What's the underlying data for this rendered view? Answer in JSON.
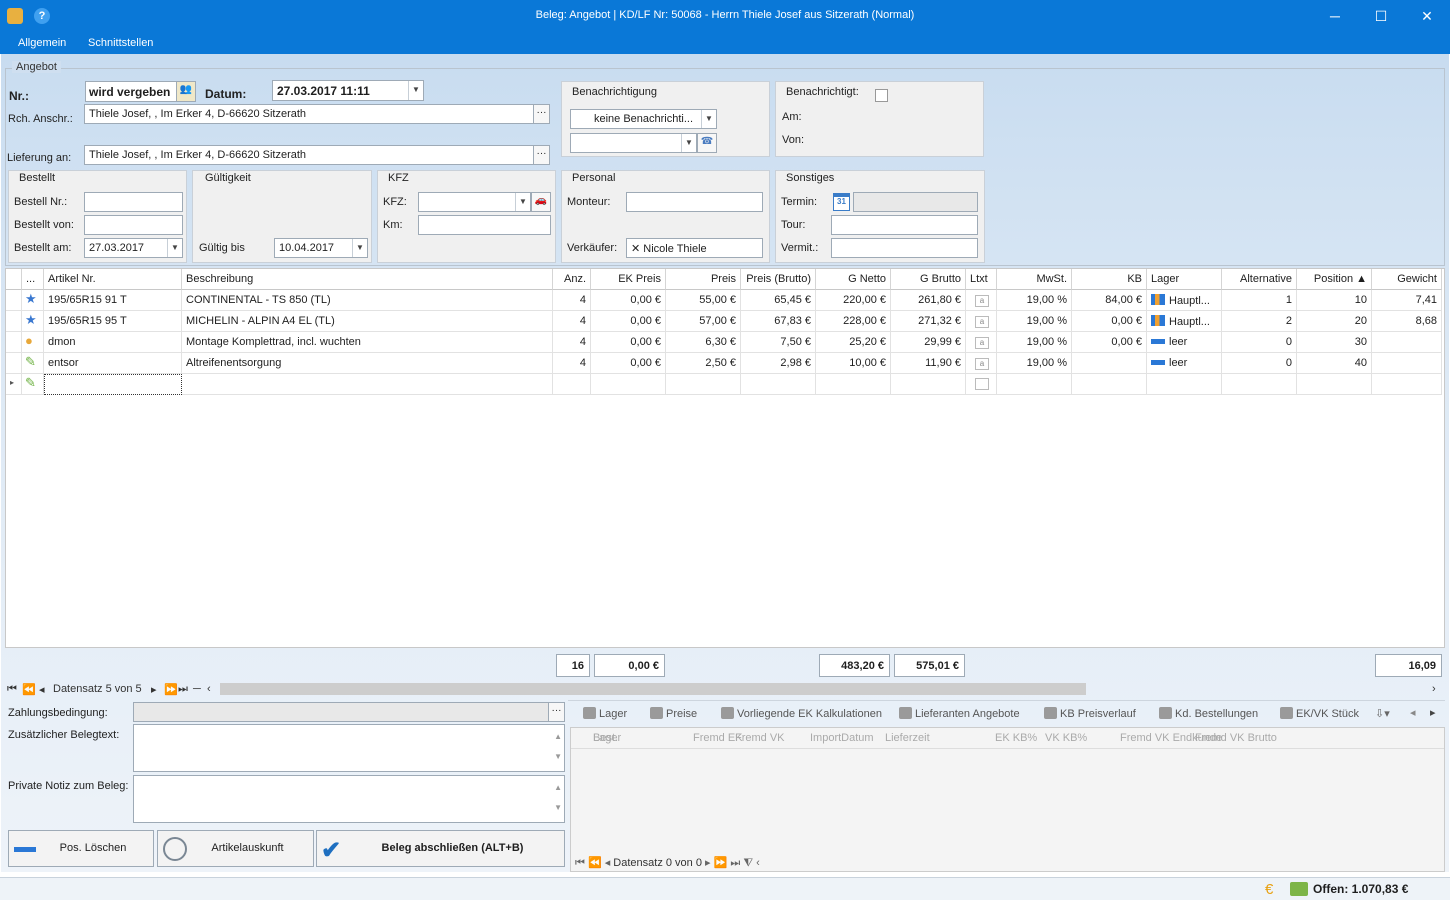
{
  "window": {
    "title": "Beleg: Angebot  |  KD/LF Nr: 50068 - Herrn Thiele Josef aus Sitzerath (Normal)",
    "minimize": "─",
    "maximize": "☐",
    "close": "✕"
  },
  "menu": [
    "Allgemein",
    "Schnittstellen"
  ],
  "angebot": {
    "group_title": "Angebot",
    "nr_label": "Nr.:",
    "nr_value": "wird vergeben",
    "datum_label": "Datum:",
    "datum_value": "27.03.2017 11:11",
    "rch_label": "Rch. Anschr.:",
    "rch_value": "Thiele Josef, , Im Erker 4, D-66620 Sitzerath",
    "lieferung_label": "Lieferung an:",
    "lieferung_value": "Thiele Josef, , Im Erker 4, D-66620 Sitzerath"
  },
  "benachrichtigung": {
    "title": "Benachrichtigung",
    "select_value": "keine Benachrichti..."
  },
  "benachrichtigt": {
    "title": "Benachrichtigt:",
    "am_label": "Am:",
    "von_label": "Von:"
  },
  "bestellt": {
    "title": "Bestellt",
    "nr_label": "Bestell Nr.:",
    "von_label": "Bestellt von:",
    "am_label": "Bestellt am:",
    "am_value": "27.03.2017"
  },
  "gueltigkeit": {
    "title": "Gültigkeit",
    "bis_label": "Gültig bis",
    "bis_value": "10.04.2017"
  },
  "kfz": {
    "title": "KFZ",
    "kfz_label": "KFZ:",
    "km_label": "Km:"
  },
  "personal": {
    "title": "Personal",
    "monteur_label": "Monteur:",
    "verkaeufer_label": "Verkäufer:",
    "verkaeufer_value": "✕ Nicole Thiele"
  },
  "sonstiges": {
    "title": "Sonstiges",
    "termin_label": "Termin:",
    "termin_icon": "31",
    "tour_label": "Tour:",
    "vermit_label": "Vermit.:"
  },
  "grid": {
    "columns": [
      "...",
      "Artikel Nr.",
      "Beschreibung",
      "Anz.",
      "EK Preis",
      "Preis",
      "Preis (Brutto)",
      "G Netto",
      "G Brutto",
      "Ltxt",
      "MwSt.",
      "KB",
      "Lager",
      "Alternative",
      "Position ▲",
      "Gewicht"
    ],
    "rows": [
      {
        "icon": "star",
        "art": "195/65R15 91 T",
        "desc": "CONTINENTAL - TS 850 (TL)",
        "anz": "4",
        "ek": "0,00 €",
        "preis": "55,00 €",
        "brutto": "65,45 €",
        "gnetto": "220,00 €",
        "gbrutto": "261,80 €",
        "ltxt": "a",
        "mwst": "19,00 %",
        "kb": "84,00 €",
        "lager": "Hauptl...",
        "lagericon": "chart",
        "alt": "1",
        "pos": "10",
        "gewicht": "7,41"
      },
      {
        "icon": "star",
        "art": "195/65R15 95 T",
        "desc": "MICHELIN - ALPIN A4 EL (TL)",
        "anz": "4",
        "ek": "0,00 €",
        "preis": "57,00 €",
        "brutto": "67,83 €",
        "gnetto": "228,00 €",
        "gbrutto": "271,32 €",
        "ltxt": "a",
        "mwst": "19,00 %",
        "kb": "0,00 €",
        "lager": "Hauptl...",
        "lagericon": "chart",
        "alt": "2",
        "pos": "20",
        "gewicht": "8,68"
      },
      {
        "icon": "person",
        "art": "dmon",
        "desc": "Montage Komplettrad, incl. wuchten",
        "anz": "4",
        "ek": "0,00 €",
        "preis": "6,30 €",
        "brutto": "7,50 €",
        "gnetto": "25,20 €",
        "gbrutto": "29,99 €",
        "ltxt": "a",
        "mwst": "19,00 %",
        "kb": "0,00 €",
        "lager": "leer",
        "lagericon": "bar",
        "alt": "0",
        "pos": "30",
        "gewicht": ""
      },
      {
        "icon": "pencil",
        "art": "entsor",
        "desc": "Altreifenentsorgung",
        "anz": "4",
        "ek": "0,00 €",
        "preis": "2,50 €",
        "brutto": "2,98 €",
        "gnetto": "10,00 €",
        "gbrutto": "11,90 €",
        "ltxt": "a",
        "mwst": "19,00 %",
        "kb": "",
        "lager": "leer",
        "lagericon": "bar",
        "alt": "0",
        "pos": "40",
        "gewicht": ""
      }
    ],
    "totals": {
      "anz": "16",
      "ek": "0,00 €",
      "gnetto": "483,20 €",
      "gbrutto": "575,01 €",
      "gewicht": "16,09"
    },
    "navigator": "Datensatz 5 von 5"
  },
  "bottom": {
    "zahlung_label": "Zahlungsbedingung:",
    "zusatz_label": "Zusätzlicher Belegtext:",
    "notiz_label": "Private Notiz zum Beleg:",
    "btn_loeschen": "Pos. Löschen",
    "btn_artikel": "Artikelauskunft",
    "btn_abschliessen": "Beleg abschließen (ALT+B)",
    "tabs": [
      "Lager",
      "Preise",
      "Vorliegende EK Kalkulationen",
      "Lieferanten Angebote",
      "KB Preisverlauf",
      "Kd. Bestellungen",
      "EK/VK Stück"
    ],
    "sub_columns": [
      "Lager",
      "Best.",
      "Fremd EK",
      "Fremd VK",
      "ImportDatum",
      "Lieferzeit",
      "EK KB%",
      "VK KB%",
      "Fremd VK Endkunde",
      "Fremd VK Brutto"
    ],
    "sub_navigator": "Datensatz 0 von 0"
  },
  "status": {
    "offen": "Offen: 1.070,83 €"
  },
  "colors": {
    "titlebar": "#0a78d7",
    "accent_blue": "#2a78d6"
  }
}
